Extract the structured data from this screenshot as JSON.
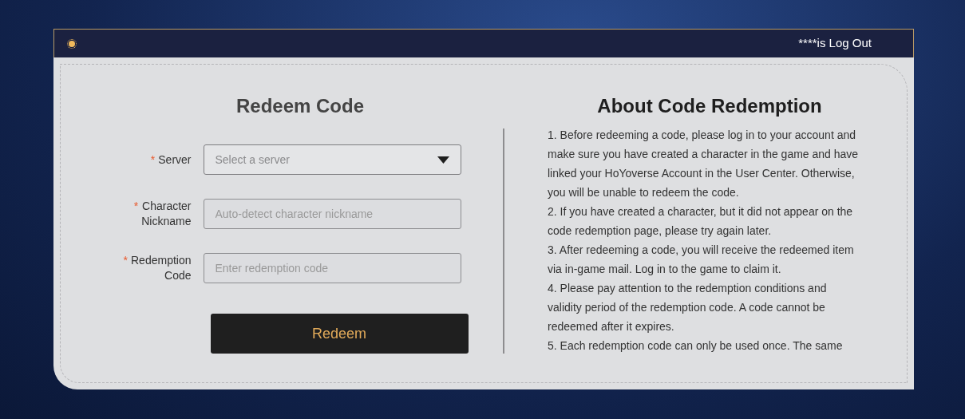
{
  "header": {
    "account_text": "****is Log Out"
  },
  "form": {
    "title": "Redeem Code",
    "fields": [
      {
        "kind": "select",
        "label_lines": [
          "Server"
        ],
        "required_mark": "*",
        "placeholder": "Select a server"
      },
      {
        "kind": "text",
        "label_lines": [
          "Character",
          "Nickname"
        ],
        "required_mark": "*",
        "placeholder": "Auto-detect character nickname"
      },
      {
        "kind": "text",
        "label_lines": [
          "Redemption",
          "Code"
        ],
        "required_mark": "*",
        "placeholder": "Enter redemption code"
      }
    ],
    "submit": "Redeem"
  },
  "about": {
    "title": "About Code Redemption",
    "notes": [
      "1. Before redeeming a code, please log in to your account and make sure you have created a character in the game and have linked your HoYoverse Account in the User Center. Otherwise, you will be unable to redeem the code.",
      "2. If you have created a character, but it did not appear on the code redemption page, please try again later.",
      "3. After redeeming a code, you will receive the redeemed item via in-game mail. Log in to the game to claim it.",
      "4. Please pay attention to the redemption conditions and validity period of the redemption code. A code cannot be redeemed after it expires.",
      "5. Each redemption code can only be used once. The same"
    ]
  }
}
